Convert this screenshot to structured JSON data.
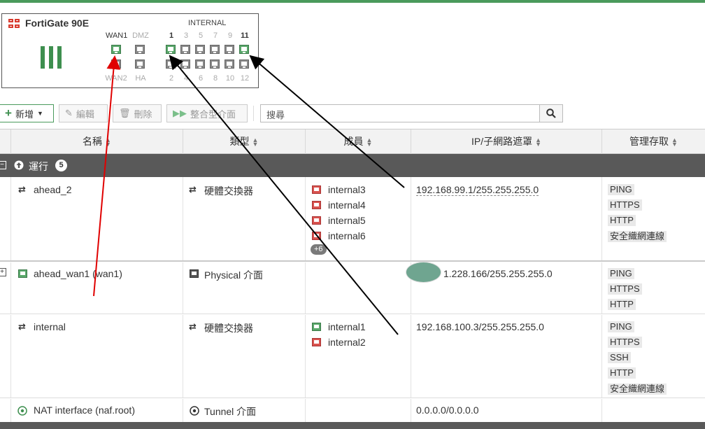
{
  "device": {
    "name": "FortiGate 90E",
    "internal_label": "INTERNAL",
    "top_ports": [
      "WAN1",
      "DMZ",
      "1",
      "3",
      "5",
      "7",
      "9",
      "11"
    ],
    "bottom_ports": [
      "WAN2",
      "HA",
      "2",
      "4",
      "6",
      "8",
      "10",
      "12"
    ]
  },
  "toolbar": {
    "new_label": "新增",
    "edit_label": "編輯",
    "delete_label": "刪除",
    "aggregate_label": "整合型介面",
    "search_placeholder": "搜尋"
  },
  "table": {
    "headers": [
      "名稱",
      "類型",
      "成員",
      "IP/子網路遮罩",
      "管理存取"
    ],
    "group": {
      "label": "運行",
      "count": "5"
    },
    "rows": [
      {
        "name": "ahead_2",
        "type": "硬體交換器",
        "members": [
          "internal3",
          "internal4",
          "internal5",
          "internal6"
        ],
        "more": "+6",
        "ip": "192.168.99.1/255.255.255.0",
        "access": [
          "PING",
          "HTTPS",
          "HTTP",
          "安全織網連線"
        ]
      },
      {
        "name": "ahead_wan1 (wan1)",
        "type": "Physical 介面",
        "members": [],
        "ip": "1.228.166/255.255.255.0",
        "access": [
          "PING",
          "HTTPS",
          "HTTP"
        ]
      },
      {
        "name": "internal",
        "type": "硬體交換器",
        "members": [
          "internal1",
          "internal2"
        ],
        "ip": "192.168.100.3/255.255.255.0",
        "access": [
          "PING",
          "HTTPS",
          "SSH",
          "HTTP",
          "安全織網連線"
        ]
      },
      {
        "name": "NAT interface (naf.root)",
        "type": "Tunnel 介面",
        "members": [],
        "ip": "0.0.0.0/0.0.0.0",
        "access": []
      }
    ]
  },
  "colors": {
    "accent": "#4a9a5c",
    "group_bar": "#595959",
    "port_up": "#5aa86b",
    "port_member": "#d9534f",
    "arrow_red": "#e00000",
    "arrow_black": "#000000"
  }
}
